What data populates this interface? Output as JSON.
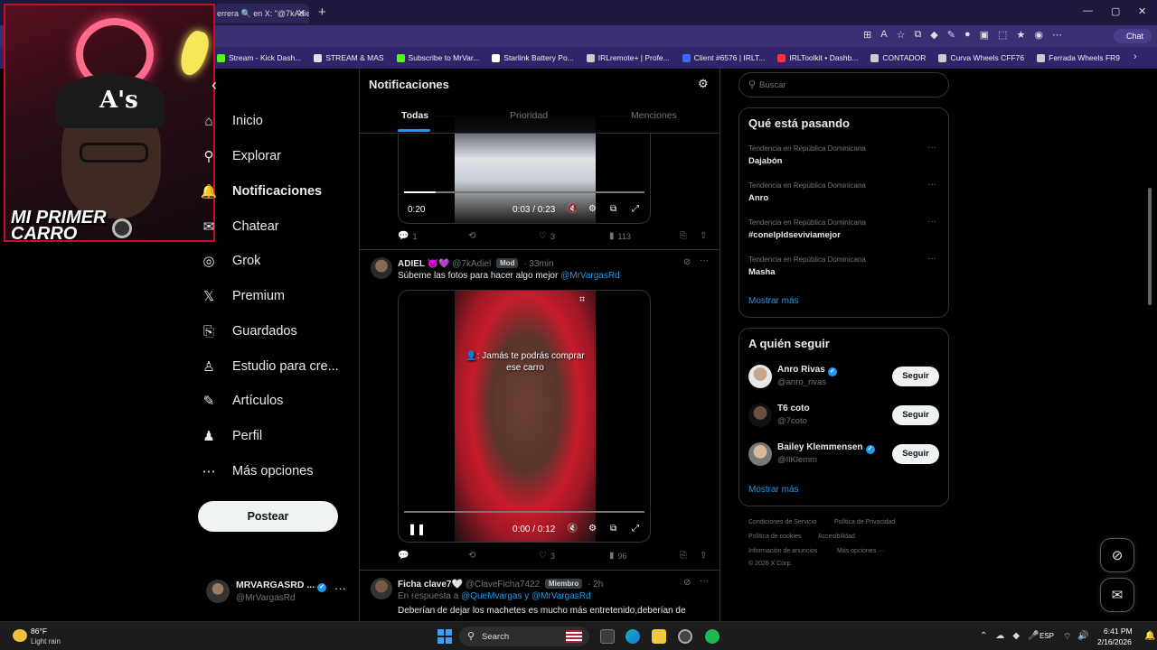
{
  "browser": {
    "tab_title": "errera 🔍 en X: \"@7kAdie",
    "tab_close": "✕",
    "new_tab": "+",
    "win_min": "—",
    "win_max": "▢",
    "win_close": "✕",
    "chat_label": "Chat",
    "bookmarks": [
      {
        "label": "Stream - Kick Dash...",
        "color": "#53fc18"
      },
      {
        "label": "STREAM & MAS",
        "color": "#e0e0e0"
      },
      {
        "label": "Subscribe to MrVar...",
        "color": "#53fc18"
      },
      {
        "label": "Starlink Battery Po...",
        "color": "#ffffff"
      },
      {
        "label": "IRLremote+ | Profe...",
        "color": "#cccccc"
      },
      {
        "label": "Client #6576 | IRLT...",
        "color": "#3a6cff"
      },
      {
        "label": "IRLToolkit • Dashb...",
        "color": "#ff3344"
      },
      {
        "label": "CONTADOR",
        "color": "#cccccc"
      },
      {
        "label": "Curva Wheels CFF76",
        "color": "#cccccc"
      },
      {
        "label": "Ferrada Wheels FR9",
        "color": "#cccccc"
      }
    ],
    "bookmarks_more": "›"
  },
  "webcam": {
    "caption_line1": "MI PRIMER",
    "caption_line2": "CARRO",
    "cap_logo": "A's"
  },
  "nav": {
    "back_icon": "‹",
    "items": [
      {
        "label": "Inicio",
        "icon": "⌂"
      },
      {
        "label": "Explorar",
        "icon": "⚲"
      },
      {
        "label": "Notificaciones",
        "icon": "🔔"
      },
      {
        "label": "Chatear",
        "icon": "✉"
      },
      {
        "label": "Grok",
        "icon": "◎"
      },
      {
        "label": "Premium",
        "icon": "𝕏"
      },
      {
        "label": "Guardados",
        "icon": "⎘"
      },
      {
        "label": "Estudio para cre...",
        "icon": "♙"
      },
      {
        "label": "Artículos",
        "icon": "✎"
      },
      {
        "label": "Perfil",
        "icon": "♟"
      },
      {
        "label": "Más opciones",
        "icon": "⋯"
      }
    ],
    "post_label": "Postear",
    "profile_name": "MRVARGASRD ...",
    "profile_handle": "@MrVargasRd",
    "profile_more": "···"
  },
  "main": {
    "title": "Notificaciones",
    "tabs": [
      "Todas",
      "Prioridad",
      "Menciones"
    ],
    "tweet1": {
      "video_time_left": "0:20",
      "video_time": "0:03 / 0:23",
      "video_progress": 0.13,
      "replies": "1",
      "likes": "3",
      "views": "113"
    },
    "tweet2": {
      "name": "ADIEL 😈💜",
      "handle": "@7kAdiel",
      "badge": "Mod",
      "time": "· 33min",
      "text": "Súbeme las fotos para hacer algo mejor ",
      "mention": "@MrVargasRd",
      "overlay_line1": "👤: Jamás te podrás comprar",
      "overlay_line2": "ese carro",
      "video_time": "0:00 / 0:12",
      "video_progress": 0.0,
      "likes": "3",
      "views": "96"
    },
    "tweet3": {
      "name": "Ficha clave7🤍",
      "handle": "@ClaveFicha7422",
      "badge": "Miembro",
      "time": "· 2h",
      "reply_prefix": "En respuesta a ",
      "reply_mentions": "@QueMvargas y @MrVargasRd",
      "text": "Deberían de dejar los machetes es mucho más entretenido,deberían de"
    }
  },
  "right": {
    "search_placeholder": "Buscar",
    "trends_title": "Qué está pasando",
    "trends": [
      {
        "context": "Tendencia en República Dominicana",
        "name": "Dajabón"
      },
      {
        "context": "Tendencia en República Dominicana",
        "name": "Anro"
      },
      {
        "context": "Tendencia en República Dominicana",
        "name": "#conelpldseviviamejor"
      },
      {
        "context": "Tendencia en República Dominicana",
        "name": "Masha"
      }
    ],
    "trends_more": "Mostrar más",
    "wtf_title": "A quién seguir",
    "who_to_follow": [
      {
        "name": "Anro Rivas",
        "handle": "@anro_rivas",
        "verified": true
      },
      {
        "name": "T6 coto",
        "handle": "@7coto",
        "verified": false
      },
      {
        "name": "Bailey Klemmensen",
        "handle": "@IlKlemm",
        "verified": true
      }
    ],
    "follow_label": "Seguir",
    "wtf_more": "Mostrar más",
    "footer": {
      "terms": "Condiciones de Servicio",
      "privacy": "Política de Privacidad",
      "cookies": "Política de cookies",
      "accessibility": "Accesibilidad",
      "ads": "Información de anuncios",
      "more": "Más opciones ···",
      "copyright": "© 2026 X Corp."
    }
  },
  "taskbar": {
    "temp": "86°F",
    "weather": "Light rain",
    "search_label": "Search",
    "lang": "ESP",
    "time": "6:41 PM",
    "date": "2/16/2026"
  }
}
